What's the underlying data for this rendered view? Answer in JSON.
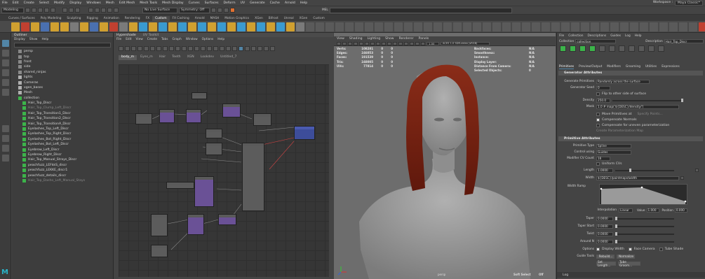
{
  "menu": [
    "File",
    "Edit",
    "Create",
    "Select",
    "Modify",
    "Display",
    "Windows",
    "Mesh",
    "Edit Mesh",
    "Mesh Tools",
    "Mesh Display",
    "Curves",
    "Surfaces",
    "Deform",
    "UV",
    "Generate",
    "Cache",
    "Arnold",
    "Help"
  ],
  "workspace": {
    "label": "Workspace :",
    "value": "Maya Classic*"
  },
  "status": {
    "mode": "Modeling",
    "live": "No Live Surface",
    "symmetry": "Symmetry: Off"
  },
  "shelf_tabs": [
    "Curves / Surfaces",
    "Poly Modeling",
    "Sculpting",
    "Rigging",
    "Animation",
    "Rendering",
    "FX",
    "Custom",
    "FX Caching",
    "Arnold",
    "MASH",
    "Motion Graphics",
    "XGen",
    "Bifrost",
    "Unreal",
    "XGen",
    "Custom"
  ],
  "outliner": {
    "title": "Outliner",
    "menu": [
      "Display",
      "Show",
      "Help"
    ],
    "items": [
      "persp",
      "top",
      "front",
      "side",
      "shared_ninjas",
      "lights",
      "Cameras",
      "xgen_bases",
      "Mesh",
      "collection",
      "Hair_Top_Discr",
      "Hair_Top_Clump_Left_Discr",
      "Hair_Top_Transition1_Discr",
      "Hair_Top_Transition2_Discr",
      "Hair_Top_TransitionA_Discr",
      "Eyelashes_Top_Left_Discr",
      "Eyelashes_Top_Right_Discr",
      "Eyelashes_Bot_Right_Discr",
      "Eyelashes_Bot_Left_Discr",
      "Eyebrow_Left_Discr",
      "Eyebrow_Right_Discr",
      "Hair_Top_Manual_Strays_Discr",
      "peachfuzz_LEFkkS_discr",
      "peachfuzz_LEKKE_discr1",
      "peachfuzz_details_discr",
      "Hair_Top_Dasho_Left_Manual_Stays"
    ]
  },
  "hypershade": {
    "title": "Hypershade",
    "tab2": "UV Toolkit",
    "menu": [
      "File",
      "Edit",
      "View",
      "Create",
      "Tabs",
      "Graph",
      "Window",
      "Options",
      "Help"
    ],
    "tabs": [
      "body_m",
      "Eyes_m",
      "Hair",
      "Teeth",
      "XGN",
      "Lookdev",
      "Untitled_7"
    ]
  },
  "viewport": {
    "menu": [
      "View",
      "Shading",
      "Lighting",
      "Show",
      "Renderer",
      "Panels"
    ],
    "hud_left": [
      [
        "Verts:",
        "108281",
        "0",
        "0"
      ],
      [
        "Edges:",
        "246053",
        "0",
        "0"
      ],
      [
        "Faces:",
        "191539",
        "0",
        "0"
      ],
      [
        "Tris:",
        "248005",
        "0",
        "0"
      ],
      [
        "UVs:",
        "77814",
        "0",
        "0"
      ]
    ],
    "hud_right": [
      [
        "Backfaces:",
        "N/A"
      ],
      [
        "Smoothness:",
        "N/A"
      ],
      [
        "Instance:",
        "N/A"
      ],
      [
        "Display Layer:",
        "N/A"
      ],
      [
        "Distance From Camera:",
        "N/A"
      ],
      [
        "Selected Objects:",
        "0"
      ]
    ],
    "camera": "persp",
    "soft_select": "Soft Select",
    "off": "Off",
    "zoom": "1.00",
    "gamma": "ACES 1.0 SDR-video (sRGB)"
  },
  "ae": {
    "tabs": [
      "File",
      "Collection",
      "Descriptions",
      "Guides",
      "Log",
      "Help"
    ],
    "collection_label": "Collection",
    "collection_value": "collection",
    "description_label": "Description",
    "description_value": "Hair_Top_Discr",
    "subtabs": [
      "Primitives",
      "Preview/Output",
      "Modifiers",
      "Grooming",
      "Utilities",
      "Expressions"
    ],
    "sec1": "Generator Attributes",
    "gen_prims_label": "Generate Primitives",
    "gen_prims_value": "Randomly across the surface",
    "seed_label": "Generator Seed",
    "seed_value": "0",
    "flip": "Flip to other side of surface",
    "density_label": "Density",
    "density_value": "250.0",
    "mask_label": "Mask",
    "mask_value": "1.0 # map('${DESC}/density/')",
    "move_prims": "Move Primitives at",
    "specify_points": "Specify Points...",
    "compensate": "Compensate Normals",
    "compensate_uneven": "Compensate for uneven parameterization",
    "create_param": "Create Parameterization Map",
    "sec2": "Primitive Attributes",
    "ptype_label": "Primitive Type",
    "ptype_value": "Spline",
    "ctrl_label": "Control using",
    "ctrl_value": "Guides",
    "cvcount_label": "Modifier CV Count",
    "cvcount_value": "16",
    "uniform": "Uniform CVs",
    "length_label": "Length",
    "length_value": "1.0000",
    "width_label": "Width",
    "width_value": "${DESC}/paintmaps/width",
    "ramp_label": "Width Ramp",
    "interp_label": "Interpolation",
    "interp_value": "Linear",
    "value_label": "Value",
    "value_value": "1.000",
    "pos_label": "Position",
    "pos_value": "0.000",
    "taper_label": "Taper",
    "taper_value": "0.0000",
    "taperstart_label": "Taper Start",
    "taperstart_value": "0.0000",
    "twist_label": "Twist",
    "twist_value": "0.0000",
    "around_label": "Around N",
    "around_value": "0.0000",
    "options_label": "Options",
    "opt_display": "Display Width",
    "opt_face": "Face Camera",
    "opt_tube": "Tube Shade",
    "guidetools_label": "Guide Tools",
    "rebuild": "Rebuild...",
    "normalize": "Normalize",
    "set_length": "Set Length...",
    "tube_groom": "Tube Groom...",
    "log": "Log"
  },
  "colors": {
    "hair": "#7a2414",
    "skin": "#9a9a9a",
    "bg": "#6d6d6d",
    "accent": "#5285a6"
  }
}
